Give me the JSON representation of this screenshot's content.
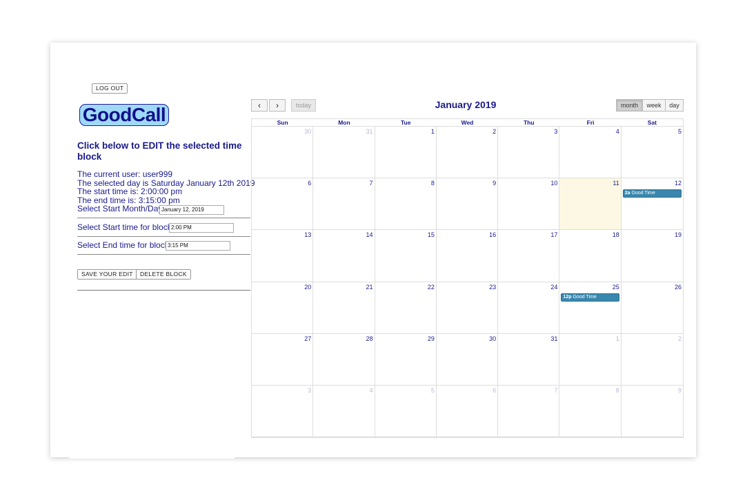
{
  "header": {
    "logout_label": "LOG OUT",
    "logo_text": "GoodCall"
  },
  "editor": {
    "heading": "Click below to EDIT the selected time block",
    "info_lines": [
      "The current user: user999",
      "The selected day is Saturday January 12th 2019",
      "The start time is: 2:00:00 pm",
      "The end time is: 3:15:00 pm"
    ],
    "start_day_label": "Select Start Month/Day:",
    "start_day_value": "January 12, 2019",
    "start_time_label": "Select Start time for block:",
    "start_time_value": "2:00 PM",
    "end_time_label": "Select End time for block:",
    "end_time_value": "3:15 PM",
    "save_label": "SAVE YOUR EDIT",
    "delete_label": "DELETE BLOCK"
  },
  "calendar": {
    "title": "January 2019",
    "prev_icon": "‹",
    "next_icon": "›",
    "today_label": "today",
    "views": [
      "month",
      "week",
      "day"
    ],
    "active_view": "month",
    "weekdays": [
      "Sun",
      "Mon",
      "Tue",
      "Wed",
      "Thu",
      "Fri",
      "Sat"
    ],
    "weeks": [
      [
        {
          "d": "30",
          "other": true
        },
        {
          "d": "31",
          "other": true
        },
        {
          "d": "1"
        },
        {
          "d": "2"
        },
        {
          "d": "3"
        },
        {
          "d": "4"
        },
        {
          "d": "5"
        }
      ],
      [
        {
          "d": "6"
        },
        {
          "d": "7"
        },
        {
          "d": "8"
        },
        {
          "d": "9"
        },
        {
          "d": "10"
        },
        {
          "d": "11",
          "today": true
        },
        {
          "d": "12",
          "event": {
            "time": "2a",
            "title": "Good Time"
          }
        }
      ],
      [
        {
          "d": "13"
        },
        {
          "d": "14"
        },
        {
          "d": "15"
        },
        {
          "d": "16"
        },
        {
          "d": "17"
        },
        {
          "d": "18"
        },
        {
          "d": "19"
        }
      ],
      [
        {
          "d": "20"
        },
        {
          "d": "21"
        },
        {
          "d": "22"
        },
        {
          "d": "23"
        },
        {
          "d": "24"
        },
        {
          "d": "25",
          "event": {
            "time": "12p",
            "title": "Good Time"
          }
        },
        {
          "d": "26"
        }
      ],
      [
        {
          "d": "27"
        },
        {
          "d": "28"
        },
        {
          "d": "29"
        },
        {
          "d": "30"
        },
        {
          "d": "31"
        },
        {
          "d": "1",
          "other": true
        },
        {
          "d": "2",
          "other": true
        }
      ],
      [
        {
          "d": "3",
          "other": true
        },
        {
          "d": "4",
          "other": true
        },
        {
          "d": "5",
          "other": true
        },
        {
          "d": "6",
          "other": true
        },
        {
          "d": "7",
          "other": true
        },
        {
          "d": "8",
          "other": true
        },
        {
          "d": "9",
          "other": true
        }
      ]
    ],
    "event_color": "#3a87ad",
    "today_color": "#fcf8e3"
  }
}
